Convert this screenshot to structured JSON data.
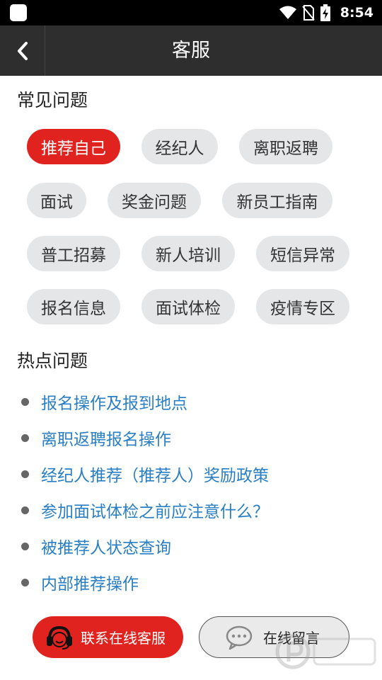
{
  "status_bar": {
    "time": "8:54"
  },
  "header": {
    "title": "客服"
  },
  "faq": {
    "title": "常见问题",
    "chips": [
      {
        "label": "推荐自己",
        "active": true
      },
      {
        "label": "经纪人",
        "active": false
      },
      {
        "label": "离职返聘",
        "active": false
      },
      {
        "label": "面试",
        "active": false
      },
      {
        "label": "奖金问题",
        "active": false
      },
      {
        "label": "新员工指南",
        "active": false
      },
      {
        "label": "普工招募",
        "active": false
      },
      {
        "label": "新人培训",
        "active": false
      },
      {
        "label": "短信异常",
        "active": false
      },
      {
        "label": "报名信息",
        "active": false
      },
      {
        "label": "面试体检",
        "active": false
      },
      {
        "label": "疫情专区",
        "active": false
      }
    ]
  },
  "hot": {
    "title": "热点问题",
    "items": [
      "报名操作及报到地点",
      "离职返聘报名操作",
      "经纪人推荐（推荐人）奖励政策",
      "参加面试体检之前应注意什么？",
      "被推荐人状态查询",
      "内部推荐操作"
    ]
  },
  "actions": {
    "contact_label": "联系在线客服",
    "contact_icon": "headset-icon",
    "message_label": "在线留言",
    "message_icon": "chat-bubble-icon"
  },
  "colors": {
    "accent": "#e1231f",
    "link": "#2a7fc4",
    "header_bg": "#2e2e2e",
    "chip_bg": "#e5e6e8"
  }
}
